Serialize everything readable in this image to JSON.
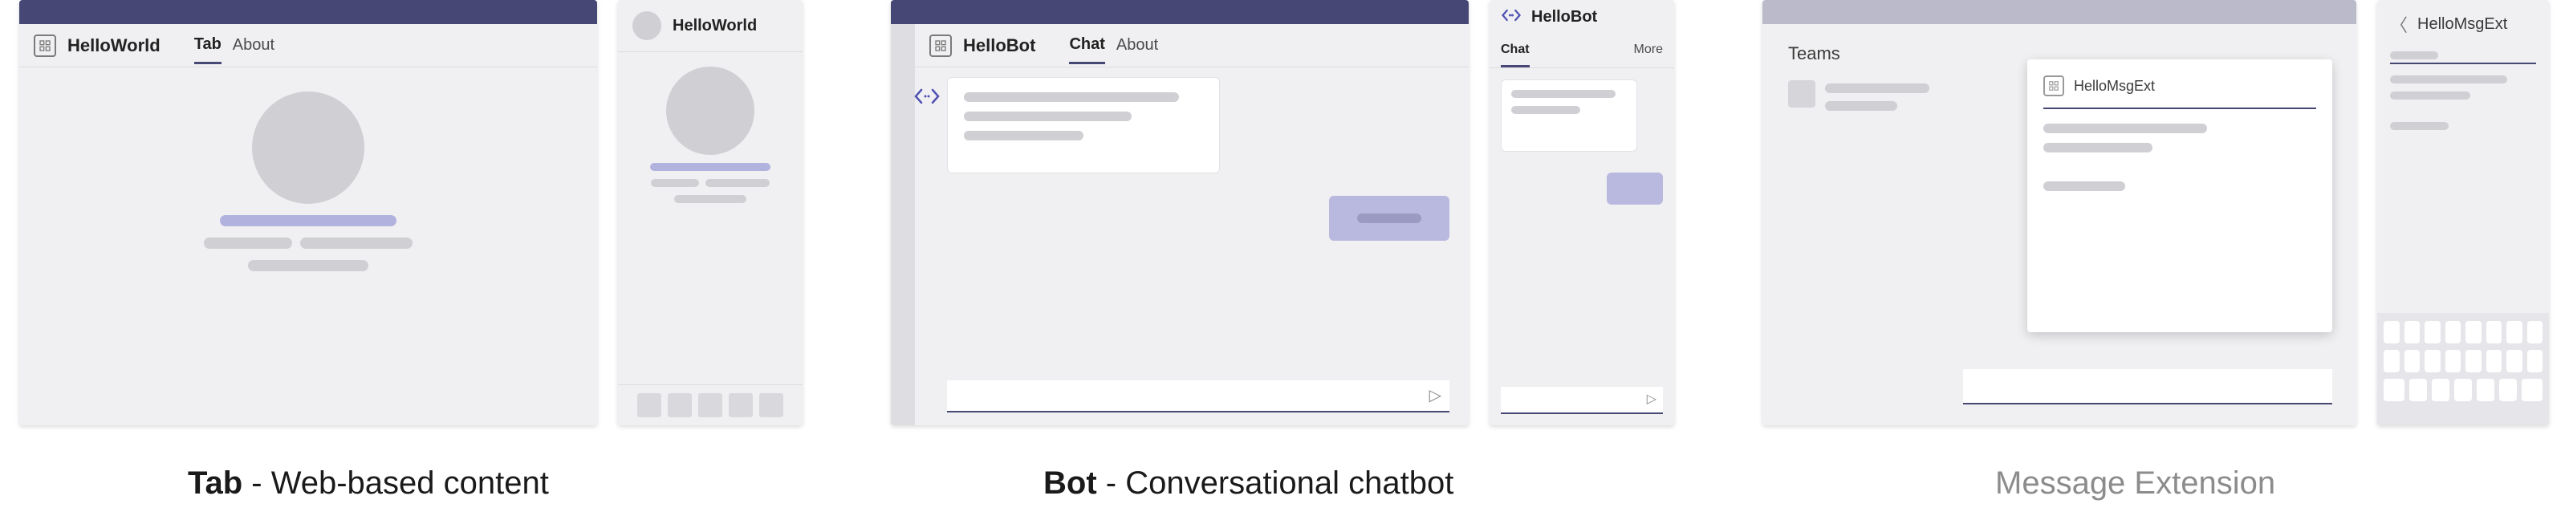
{
  "captions": {
    "tab_strong": "Tab",
    "tab_rest": " - Web-based content",
    "bot_strong": "Bot",
    "bot_rest": " - Conversational chatbot",
    "msgext": "Message Extension"
  },
  "tab": {
    "app_name": "HelloWorld",
    "tabs": {
      "tab": "Tab",
      "about": "About"
    },
    "mobile_title": "HelloWorld"
  },
  "bot": {
    "app_name": "HelloBot",
    "tabs": {
      "chat": "Chat",
      "about": "About"
    },
    "mobile_title": "HelloBot",
    "mobile_tabs": {
      "chat": "Chat",
      "more": "More"
    }
  },
  "msgext": {
    "teams_label": "Teams",
    "card_title": "HelloMsgExt",
    "mobile_title": "HelloMsgExt"
  },
  "icons": {
    "app": "app-grid-icon",
    "code": "code-icon",
    "send": "send-icon",
    "back": "chevron-left-icon"
  }
}
